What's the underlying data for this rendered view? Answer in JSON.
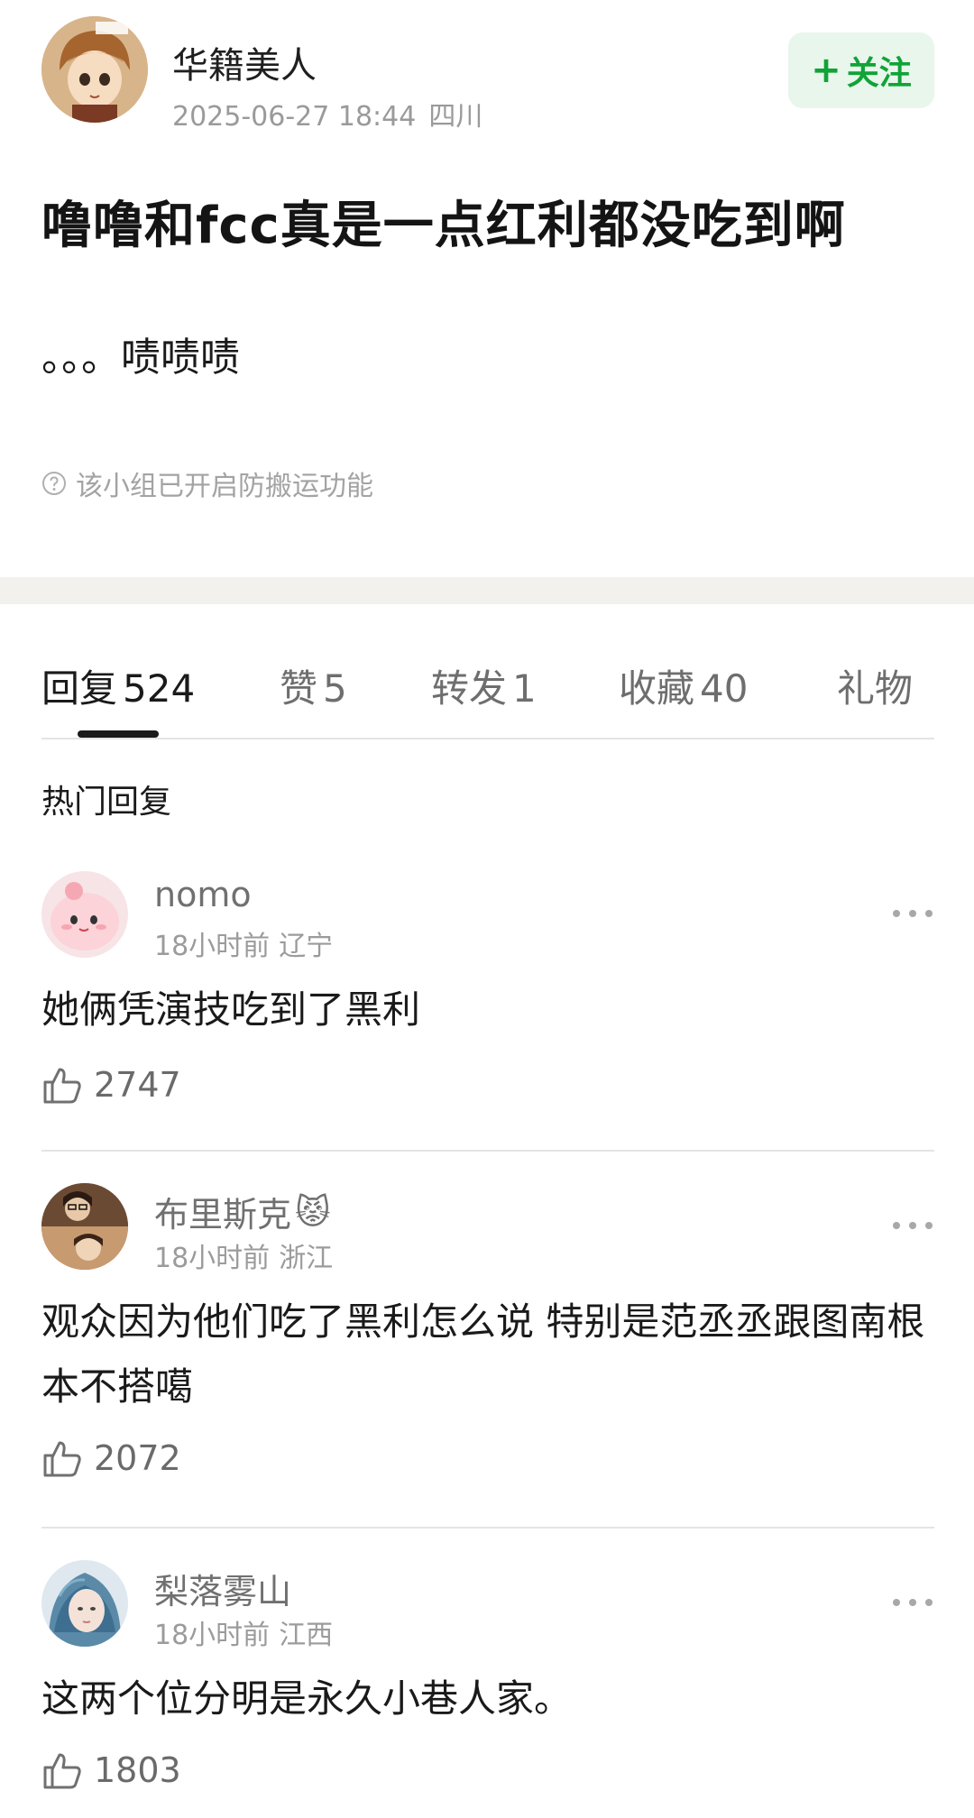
{
  "author": {
    "name": "华籍美人",
    "date": "2025-06-27 18:44",
    "location": "四川",
    "follow_plus": "+",
    "follow_label": "关注",
    "avatar_icon": "cartoon-girl-avatar"
  },
  "post": {
    "title": "噜噜和fcc真是一点红利都没吃到啊",
    "body": "。。。啧啧啧",
    "notice": "该小组已开启防搬运功能"
  },
  "tabs": [
    {
      "label": "回复",
      "count": "524"
    },
    {
      "label": "赞",
      "count": "5"
    },
    {
      "label": "转发",
      "count": "1"
    },
    {
      "label": "收藏",
      "count": "40"
    },
    {
      "label": "礼物",
      "count": ""
    }
  ],
  "section_title": "热门回复",
  "comments": [
    {
      "name": "nomo",
      "emoji": "",
      "time": "18小时前",
      "location": "辽宁",
      "text": "她俩凭演技吃到了黑利",
      "likes": "2747"
    },
    {
      "name": "布里斯克",
      "emoji": "😾",
      "time": "18小时前",
      "location": "浙江",
      "text": "观众因为他们吃了黑利怎么说  特别是范丞丞跟图南根本不搭噶",
      "likes": "2072"
    },
    {
      "name": "梨落雾山",
      "emoji": "",
      "time": "18小时前",
      "location": "江西",
      "text": "这两个位分明是永久小巷人家。",
      "likes": "1803"
    }
  ],
  "colors": {
    "accent_green": "#10a336",
    "follow_bg": "#e8f6ec",
    "band": "#f2f1ee"
  }
}
